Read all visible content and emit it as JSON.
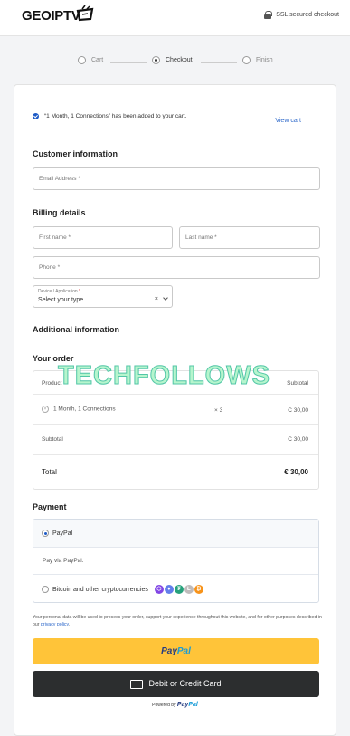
{
  "header": {
    "logo": "GEOIPTV",
    "ssl_label": "SSL secured checkout"
  },
  "steps": [
    {
      "label": "Cart"
    },
    {
      "label": "Checkout"
    },
    {
      "label": "Finish"
    }
  ],
  "notice": {
    "text": "“1 Month, 1 Connections” has been added to your cart.",
    "view_cart": "View cart"
  },
  "customer": {
    "heading": "Customer information",
    "email_placeholder": "Email Address *"
  },
  "billing": {
    "heading": "Billing details",
    "first_name": "First name *",
    "last_name": "Last name *",
    "phone": "Phone *",
    "device_label": "Device / Application",
    "device_required": "*",
    "device_value": "Select your type",
    "clear": "×"
  },
  "additional": {
    "heading": "Additional information"
  },
  "order": {
    "heading": "Your order",
    "col_product": "Product",
    "col_subtotal": "Subtotal",
    "item": {
      "name": "1 Month, 1 Connections",
      "qty": "× 3",
      "price": "C 30,00",
      "remove": "×"
    },
    "subtotal_label": "Subtotal",
    "subtotal_value": "C 30,00",
    "total_label": "Total",
    "total_value": "€ 30,00"
  },
  "payment": {
    "heading": "Payment",
    "paypal_label": "PayPal",
    "paypal_desc": "Pay via PayPal.",
    "crypto_label": "Bitcoin and other cryptocurrencies",
    "crypto_icons": [
      {
        "name": "polygon-icon",
        "color": "#8247e5",
        "glyph": "⬡"
      },
      {
        "name": "ethereum-icon",
        "color": "#627eea",
        "glyph": "♦"
      },
      {
        "name": "tether-icon",
        "color": "#26a17b",
        "glyph": "₮"
      },
      {
        "name": "litecoin-icon",
        "color": "#bfbbbb",
        "glyph": "Ł"
      },
      {
        "name": "bitcoin-icon",
        "color": "#f7931a",
        "glyph": "₿"
      }
    ]
  },
  "privacy": {
    "text": "Your personal data will be used to process your order, support your experience throughout this website, and for other purposes described in our ",
    "link": "privacy policy",
    "end": "."
  },
  "buttons": {
    "paypal_p1": "Pay",
    "paypal_p2": "Pal",
    "card": "Debit or Credit Card",
    "powered_by": "Powered by ",
    "powered_p1": "Pay",
    "powered_p2": "Pal"
  },
  "watermark": "TECHFOLLOWS",
  "colors": {
    "accent": "#2a66c9",
    "paypal_yellow": "#ffc439",
    "card_button": "#2c2e2f"
  }
}
